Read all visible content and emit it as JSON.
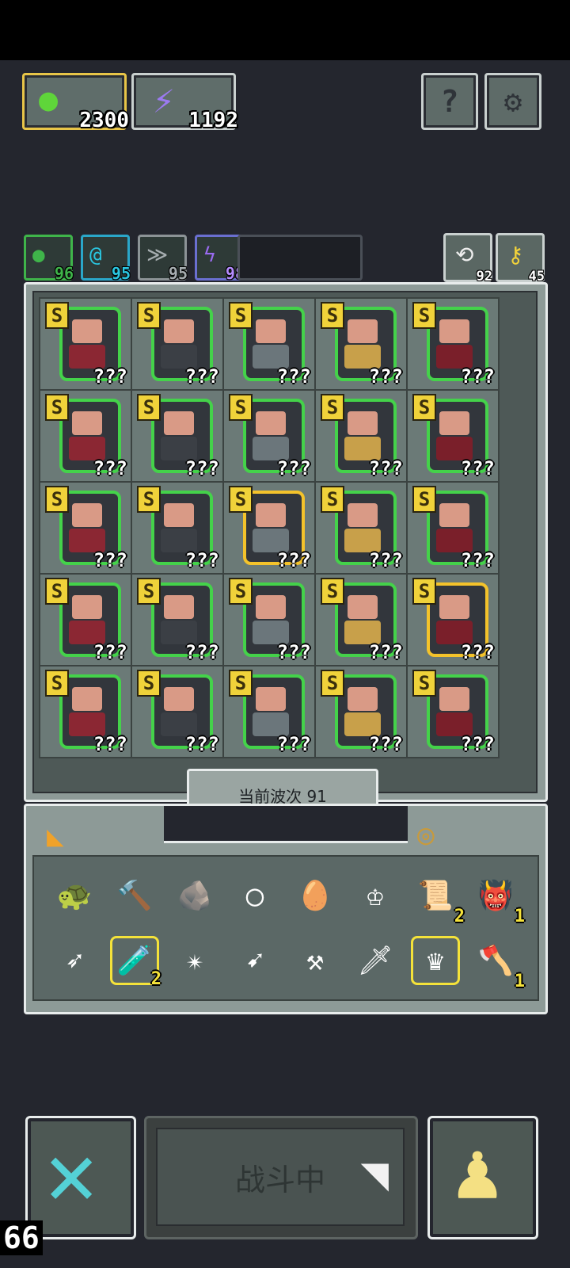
{
  "resources": {
    "slime_count": "2300",
    "energy_count": "1192"
  },
  "top_buttons": {
    "help_label": "?",
    "settings_label": "⚙"
  },
  "gems": [
    {
      "value": "96",
      "color": "#3fb44a"
    },
    {
      "value": "95",
      "color": "#2aa7c9"
    },
    {
      "value": "95",
      "color": "#8c9396"
    },
    {
      "value": "98",
      "color": "#9a6bf0"
    }
  ],
  "counters": {
    "refresh": "92",
    "key": "45"
  },
  "board": {
    "rank": "S",
    "unknown": "???",
    "wave_label": "当前波次 91"
  },
  "inventory": {
    "items": [
      {
        "icon": "turtle-shell-icon",
        "glyph": "🐢",
        "count": ""
      },
      {
        "icon": "hammer-icon",
        "glyph": "🔨",
        "count": ""
      },
      {
        "icon": "sling-icon",
        "glyph": "🪨",
        "count": ""
      },
      {
        "icon": "ring-icon",
        "glyph": "◯",
        "count": ""
      },
      {
        "icon": "mirror-icon",
        "glyph": "🥚",
        "count": ""
      },
      {
        "icon": "crown-icon",
        "glyph": "♔",
        "count": ""
      },
      {
        "icon": "scroll-icon",
        "glyph": "📜",
        "count": "2"
      },
      {
        "icon": "demon-mask-icon",
        "glyph": "👹",
        "count": "1"
      },
      {
        "icon": "arrow-icon",
        "glyph": "➶",
        "count": ""
      },
      {
        "icon": "potion-icon",
        "glyph": "🧪",
        "count": "2"
      },
      {
        "icon": "staff-icon",
        "glyph": "✴",
        "count": ""
      },
      {
        "icon": "pink-arrow-icon",
        "glyph": "➹",
        "count": ""
      },
      {
        "icon": "anvil-icon",
        "glyph": "⚒",
        "count": ""
      },
      {
        "icon": "dagger-icon",
        "glyph": "🗡",
        "count": ""
      },
      {
        "icon": "claw-icon",
        "glyph": "♛",
        "count": ""
      },
      {
        "icon": "axe-icon",
        "glyph": "🪓",
        "count": "1"
      }
    ]
  },
  "bottom": {
    "fight_label": "战斗中",
    "fps": "66"
  }
}
